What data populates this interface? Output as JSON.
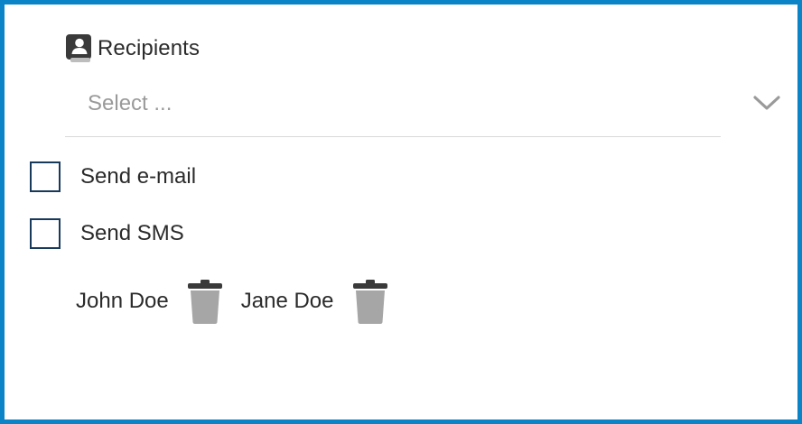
{
  "recipients": {
    "label": "Recipients",
    "icon": "contact-book-icon",
    "placeholder": "Select ..."
  },
  "options": [
    {
      "label": "Send e-mail",
      "checked": false
    },
    {
      "label": "Send SMS",
      "checked": false
    }
  ],
  "selected_recipients": [
    {
      "name": "John Doe",
      "icon": "trash-icon"
    },
    {
      "name": "Jane Doe",
      "icon": "trash-icon"
    }
  ],
  "colors": {
    "frame_border": "#0a84c6",
    "checkbox_border": "#173a5c",
    "icon_gray": "#a6a6a6",
    "text": "#2b2b2b",
    "placeholder": "#9a9a9a"
  }
}
